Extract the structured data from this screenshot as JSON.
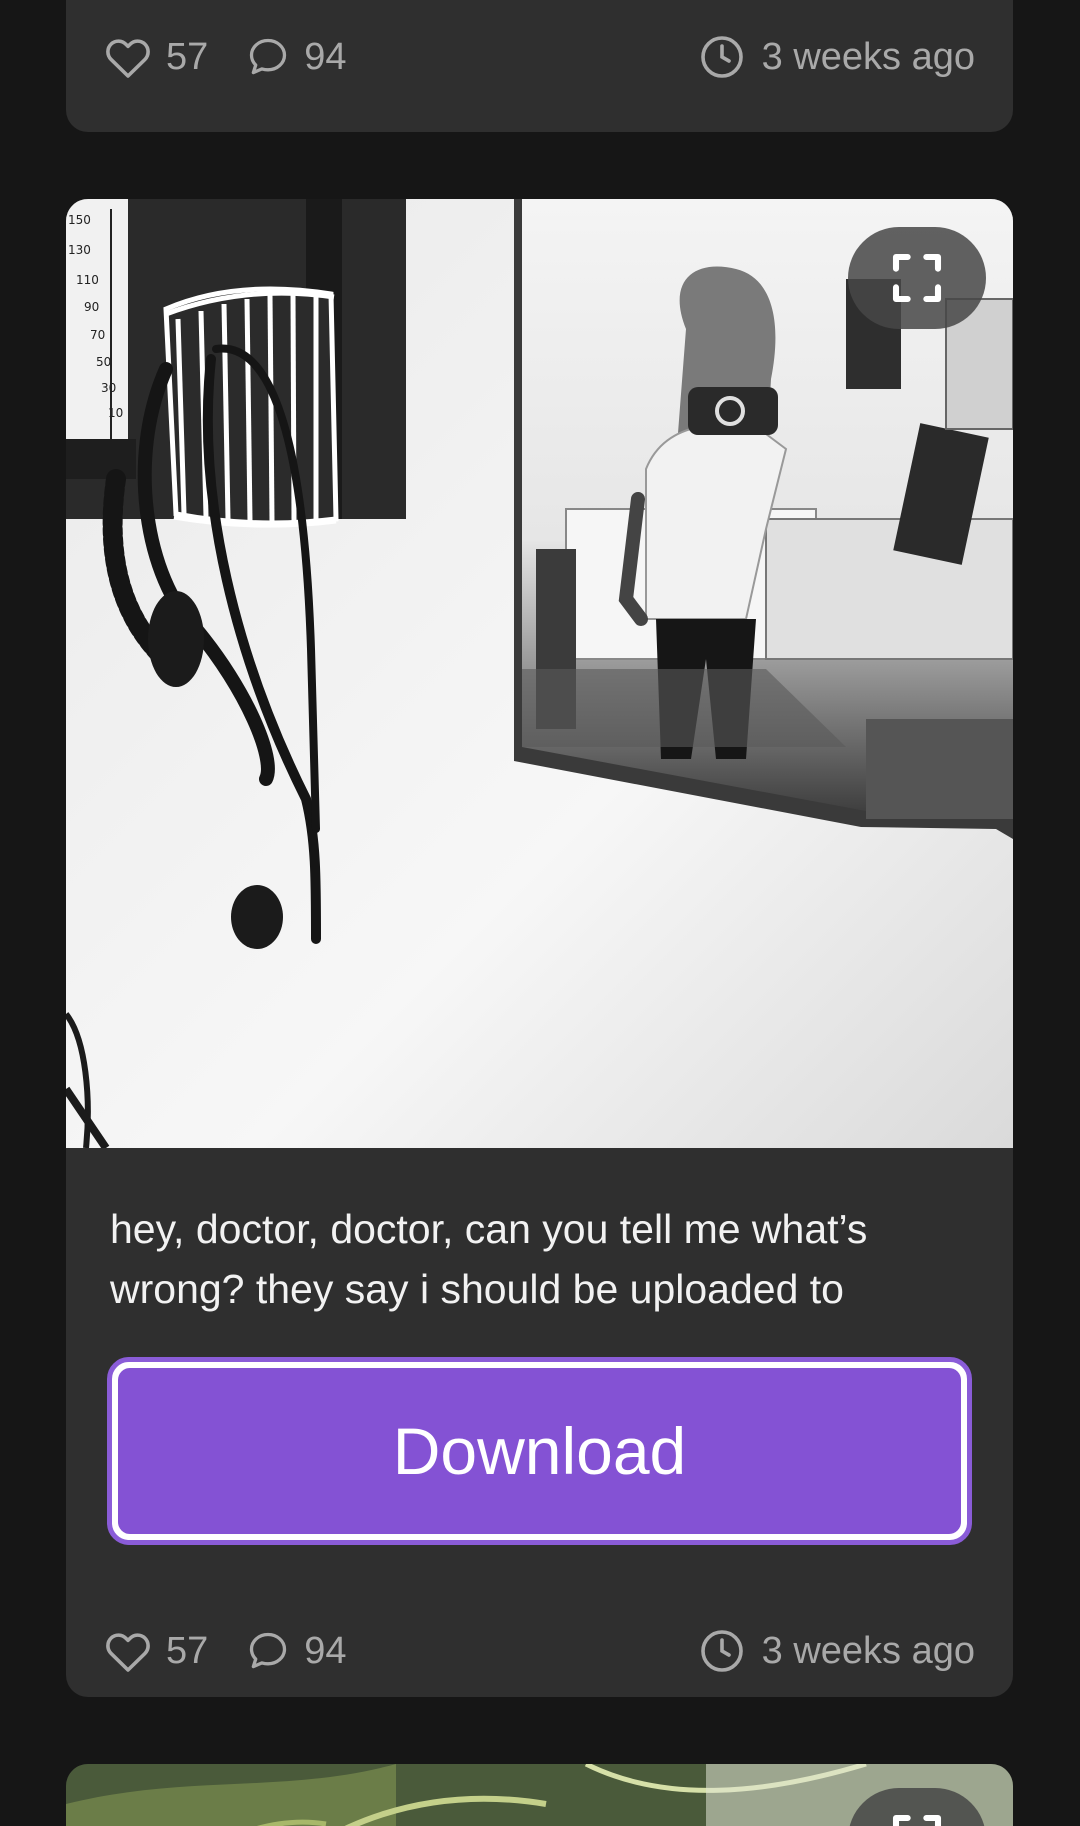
{
  "posts": [
    {
      "likes": "57",
      "comments": "94",
      "time": "3 weeks ago"
    },
    {
      "likes": "57",
      "comments": "94",
      "time": "3 weeks ago",
      "caption": "hey, doctor, doctor, can you tell me what’s wrong? they say i should be uploaded to",
      "download_label": "Download",
      "photo_scale_labels": [
        "150",
        "130",
        "110",
        "90",
        "70",
        "50",
        "30",
        "10"
      ]
    }
  ],
  "icons": {
    "like": "heart-icon",
    "comment": "comment-bubble-icon",
    "time": "clock-icon",
    "expand": "fullscreen-icon"
  },
  "colors": {
    "background": "#161616",
    "card": "#2f2f2f",
    "meta_text": "#a9a9a9",
    "accent": "#8452d4"
  }
}
